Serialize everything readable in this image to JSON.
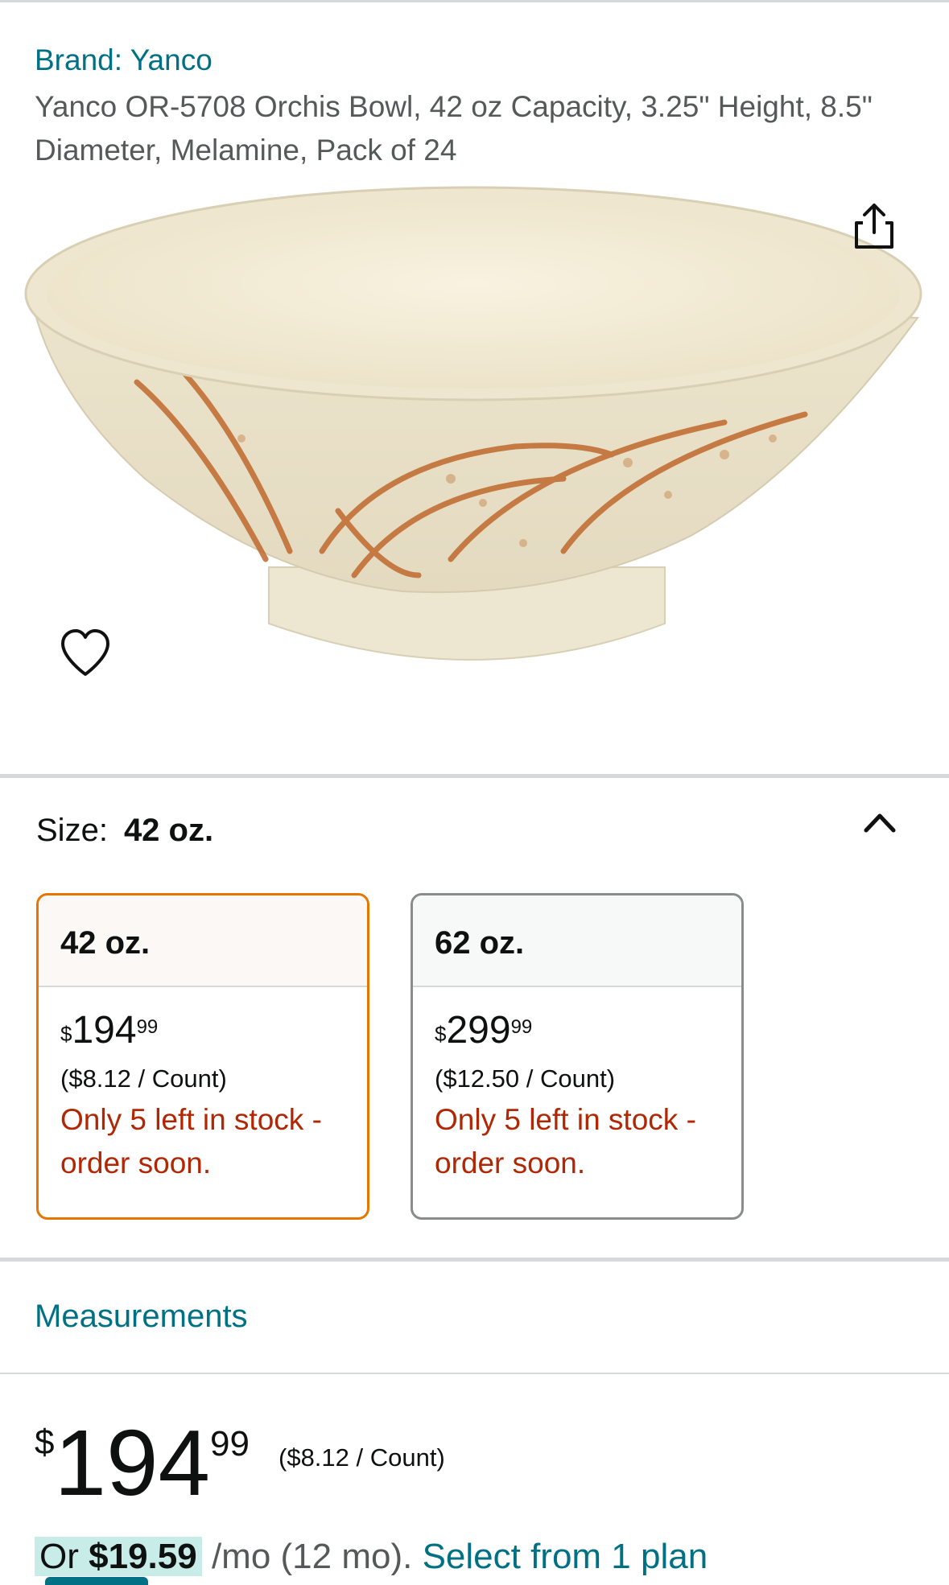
{
  "product": {
    "brand": "Brand: Yanco",
    "title": "Yanco OR-5708 Orchis Bowl, 42 oz Capacity, 3.25\" Height, 8.5\" Diameter, Melamine, Pack of 24",
    "image_icon": "product-bowl-image"
  },
  "actions": {
    "share_icon": "share-icon",
    "wishlist_icon": "heart-icon"
  },
  "size": {
    "label": "Size:",
    "selected": "42 oz.",
    "options": [
      {
        "name": "42 oz.",
        "currency": "$",
        "whole": "194",
        "fraction": "99",
        "unit_price": "($8.12 / Count)",
        "stock": "Only 5 left in stock - order soon.",
        "selected": true
      },
      {
        "name": "62 oz.",
        "currency": "$",
        "whole": "299",
        "fraction": "99",
        "unit_price": "($12.50 / Count)",
        "stock": "Only 5 left in stock - order soon.",
        "selected": false
      }
    ]
  },
  "measurements": {
    "label": "Measurements"
  },
  "price": {
    "currency": "$",
    "whole": "194",
    "fraction": "99",
    "unit_price": "($8.12 / Count)"
  },
  "installment": {
    "prefix": "Or",
    "amount": "$19.59",
    "term": "/mo (12 mo).",
    "link": "Select from 1 plan"
  },
  "colors": {
    "link": "#007185",
    "stock": "#b12704",
    "selected_border": "#e77600"
  }
}
